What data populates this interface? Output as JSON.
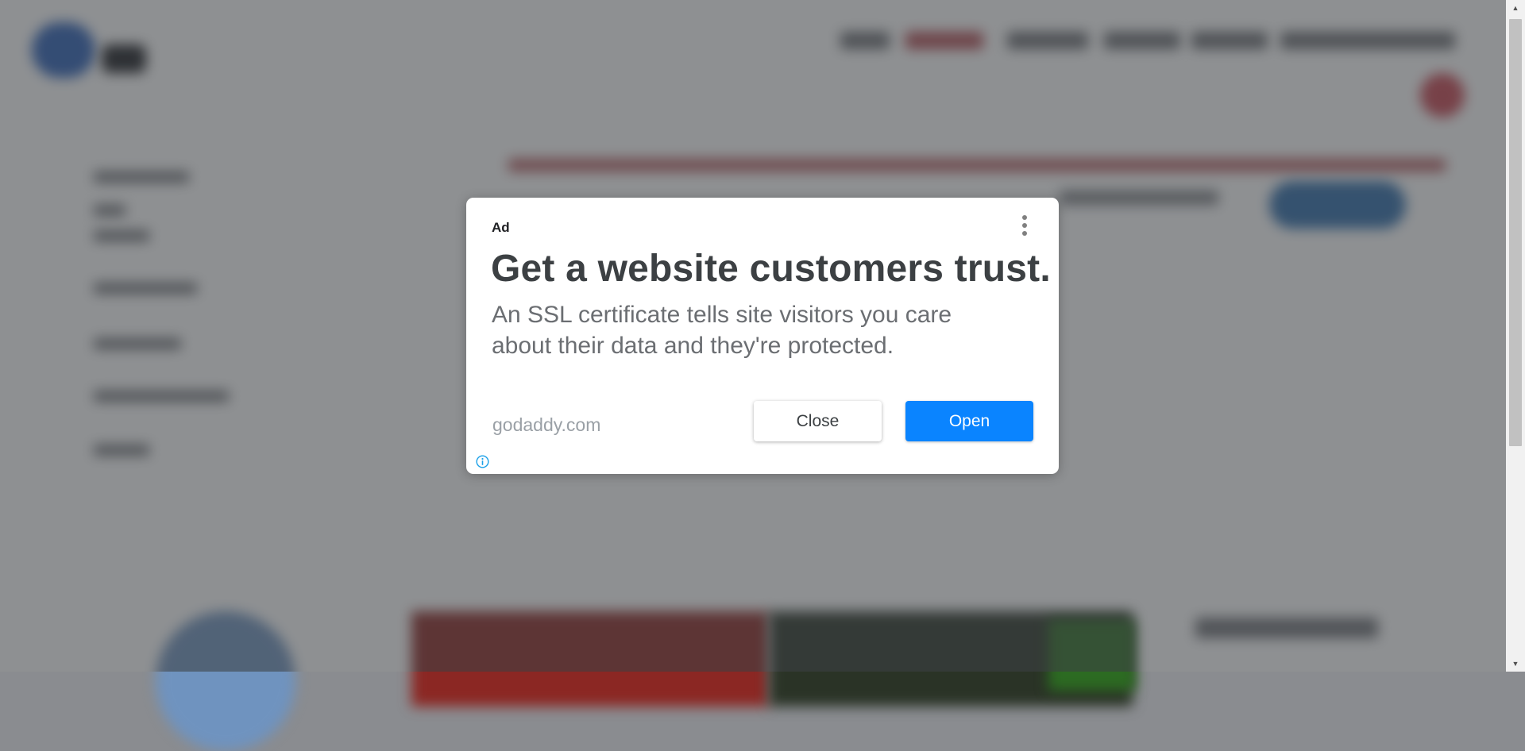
{
  "ad": {
    "label": "Ad",
    "headline": "Get a website customers trust.",
    "description": "An SSL certificate tells site visitors you care about their data and they're protected.",
    "domain": "godaddy.com",
    "close_label": "Close",
    "open_label": "Open",
    "menu_icon": "more-vert-icon",
    "info_icon": "info-icon"
  },
  "colors": {
    "overlay": "#8a8c90",
    "dialog_bg": "#ffffff",
    "headline_text": "#3c4043",
    "open_button": "#0a84ff",
    "info_icon": "#1aa0e8"
  }
}
